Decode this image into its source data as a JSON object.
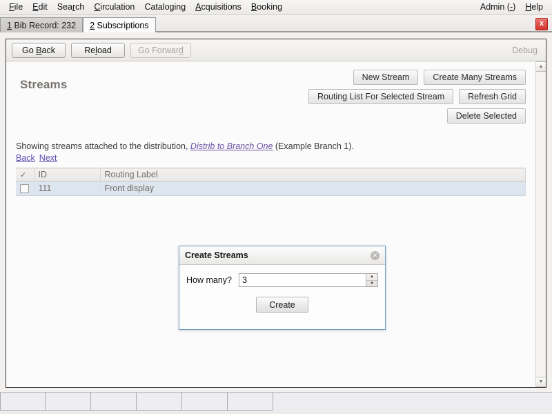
{
  "menubar": {
    "items": [
      {
        "label": "File",
        "accel": "F"
      },
      {
        "label": "Edit",
        "accel": "E"
      },
      {
        "label": "Search",
        "accel": "r"
      },
      {
        "label": "Circulation",
        "accel": "C"
      },
      {
        "label": "Cataloging",
        "accel": "g"
      },
      {
        "label": "Acquisitions",
        "accel": "A"
      },
      {
        "label": "Booking",
        "accel": "B"
      }
    ],
    "right": [
      {
        "label": "Admin (-)",
        "accel": "-"
      },
      {
        "label": "Help",
        "accel": "H"
      }
    ]
  },
  "tabs": [
    {
      "num": "1",
      "label": "Bib Record: 232",
      "active": false
    },
    {
      "num": "2",
      "label": "Subscriptions",
      "active": true
    }
  ],
  "window": {
    "close_label": "x"
  },
  "navbar": {
    "back_label": "Go Back",
    "back_accel": "B",
    "reload_label": "Reload",
    "reload_accel": "l",
    "forward_label": "Go Forward",
    "forward_accel": "d",
    "forward_disabled": true,
    "debug_label": "Debug"
  },
  "page": {
    "title": "Streams",
    "buttons": {
      "new_stream": "New Stream",
      "create_many_streams": "Create Many Streams",
      "routing_list": "Routing List For Selected Stream",
      "refresh_grid": "Refresh Grid",
      "delete_selected": "Delete Selected"
    },
    "description": {
      "prefix": "Showing streams attached to the distribution, ",
      "link": "Distrib to Branch One",
      "suffix": " (Example Branch 1)."
    },
    "pager": {
      "back": "Back",
      "next": "Next"
    },
    "grid": {
      "columns": [
        "✓",
        "ID",
        "Routing Label"
      ],
      "rows": [
        {
          "selected": true,
          "id": "111",
          "routing_label": "Front display"
        }
      ]
    }
  },
  "modal": {
    "title": "Create Streams",
    "close_label": "✕",
    "field_label": "How many?",
    "field_value": "3",
    "spin_up": "▲",
    "spin_down": "▼",
    "create_label": "Create"
  },
  "scrollbar": {
    "up_label": "▲",
    "down_label": "▼"
  },
  "statusbar": {
    "cells": [
      "",
      "",
      "",
      "",
      "",
      ""
    ]
  },
  "colors": {
    "accent_blue": "#6e9cc4",
    "link_purple": "#5a4fb0",
    "selected_row": "#dde6ee",
    "close_red": "#d5362f"
  }
}
